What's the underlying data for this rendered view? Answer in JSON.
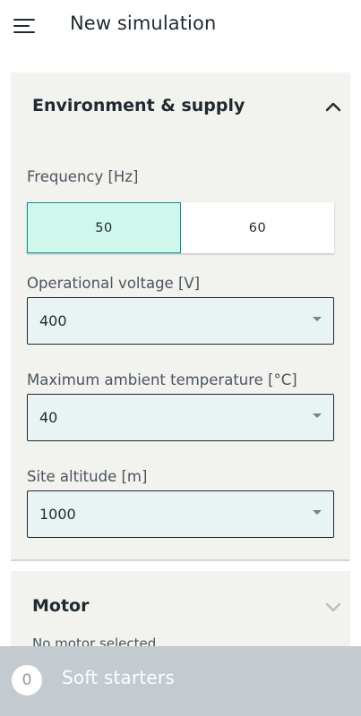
{
  "header": {
    "menu_icon": "hamburger-menu-icon",
    "title": "New simulation"
  },
  "environment": {
    "title": "Environment & supply",
    "toggle_icon": "chevron-up-icon",
    "expanded": true,
    "frequency": {
      "label": "Frequency [Hz]",
      "options": [
        "50",
        "60"
      ],
      "selected": "50"
    },
    "voltage": {
      "label": "Operational voltage [V]",
      "value": "400"
    },
    "temperature": {
      "label": "Maximum ambient temperature [°C]",
      "value": "40"
    },
    "altitude": {
      "label": "Site altitude [m]",
      "value": "1000"
    }
  },
  "motor": {
    "title": "Motor",
    "hint": "No motor selected",
    "toggle_icon": "chevron-down-icon"
  },
  "bottom_bar": {
    "count": "0",
    "label": "Soft starters"
  },
  "colors": {
    "accent": "#009999",
    "selected_bg": "#cff7ec",
    "select_bg": "#e8f4f4",
    "section_bg": "#f2f2ef",
    "bottom_bar_bg": "#c3cbd1"
  }
}
